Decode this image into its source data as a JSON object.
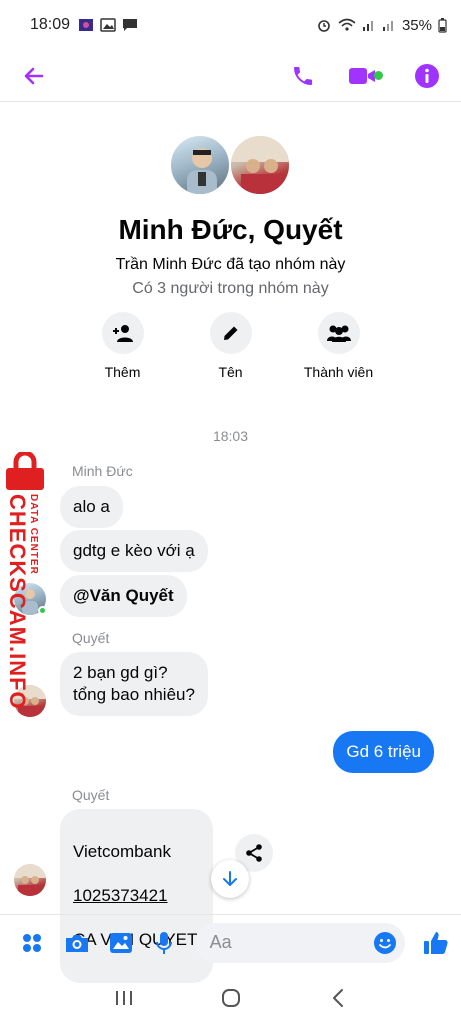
{
  "status_bar": {
    "time": "18:09",
    "battery": "35%"
  },
  "group": {
    "name": "Minh Đức, Quyết",
    "creator_text": "Trần Minh Đức đã tạo nhóm này",
    "member_count_text": "Có 3 người trong nhóm này",
    "actions": [
      {
        "label": "Thêm",
        "icon": "add-person-icon"
      },
      {
        "label": "Tên",
        "icon": "pencil-icon"
      },
      {
        "label": "Thành viên",
        "icon": "members-icon"
      }
    ]
  },
  "chat": {
    "timestamp": "18:03",
    "sender1": "Minh Đức",
    "msg1": "alo a",
    "msg2": "gdtg e kèo với ạ",
    "msg3": "@Văn Quyết",
    "sender2": "Quyết",
    "msg4": "2 bạn gd gì?\ntổng bao nhiêu?",
    "msg5": "Gd 6 triệu",
    "sender3": "Quyết",
    "msg6_bank": "Vietcombank",
    "msg6_account": "1025373421",
    "msg6_name": "CA VAN QUYET"
  },
  "watermark": {
    "title": "CHECKSCAM.INFO",
    "subtitle": "DATA CENTER"
  },
  "composer": {
    "placeholder": "Aa"
  },
  "colors": {
    "accent": "#a033ff",
    "messenger_blue": "#1877f2",
    "online": "#31c748",
    "watermark": "#e02020"
  }
}
